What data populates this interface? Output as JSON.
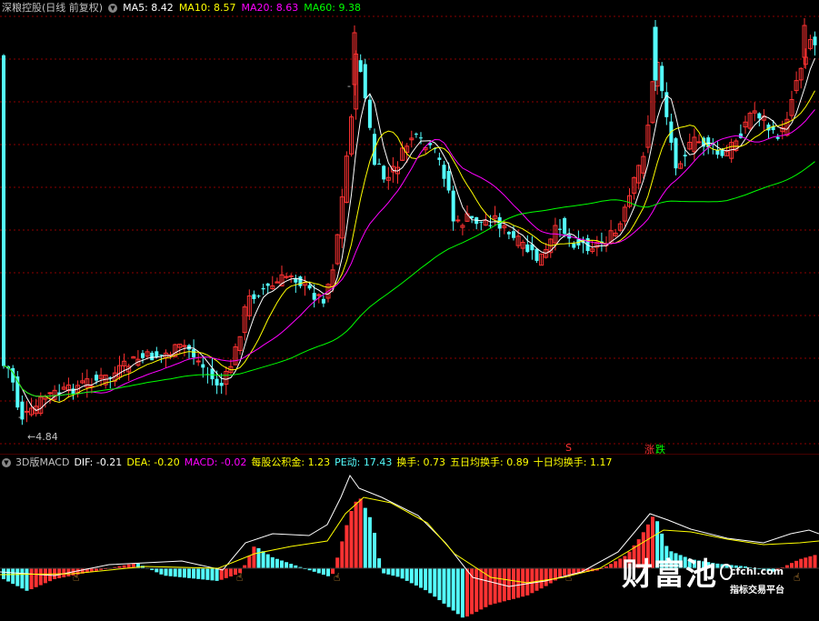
{
  "top_header": {
    "stock": "深粮控股(日线 前复权)",
    "ma5": "MA5: 8.42",
    "ma10": "MA10: 8.57",
    "ma20": "MA20: 8.63",
    "ma60": "MA60: 9.38"
  },
  "main_chart": {
    "low_label": "←4.84",
    "s_marker": "S",
    "zhang_marker": "涨",
    "die_marker": "跌",
    "dash_label": "-"
  },
  "macd_header": {
    "name": "3D版MACD",
    "dif": "DIF: -0.21",
    "dea": "DEA: -0.20",
    "macd": "MACD: -0.02",
    "gongjijin": "每股公积金: 1.23",
    "pe": "PE动: 17.43",
    "huanshou": "换手: 0.73",
    "huanshou5": "五日均换手: 0.89",
    "huanshou10": "十日均换手: 1.17"
  },
  "watermark": {
    "title": "财富池",
    "domain": "cfchi.com",
    "subtitle": "指标交易平台"
  },
  "colors": {
    "up": "#ff3232",
    "down": "#54ffff",
    "ma5": "#ffffff",
    "ma10": "#ffff00",
    "ma20": "#ff00ff",
    "ma60": "#00ff00",
    "grid": "#8b0000",
    "text_gray": "#c0c0c0"
  },
  "icons": {
    "settings": "circle-chevron-icon",
    "cursor": "hand-pointer-icon"
  }
}
